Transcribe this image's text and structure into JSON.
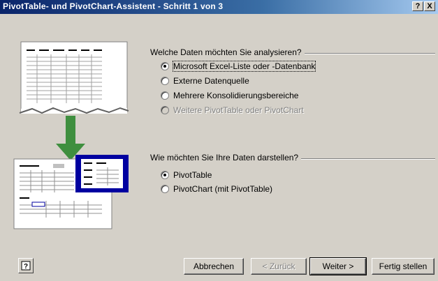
{
  "window": {
    "title": "PivotTable- und PivotChart-Assistent - Schritt 1 von 3",
    "help_glyph": "?",
    "close_glyph": "X"
  },
  "group_data_source": {
    "label": "Welche Daten möchten Sie analysieren?",
    "options": [
      {
        "label": "Microsoft Excel-Liste oder -Datenbank",
        "checked": true,
        "disabled": false
      },
      {
        "label": "Externe Datenquelle",
        "checked": false,
        "disabled": false
      },
      {
        "label": "Mehrere Konsolidierungsbereiche",
        "checked": false,
        "disabled": false
      },
      {
        "label": "Weitere PivotTable oder PivotChart",
        "checked": false,
        "disabled": true
      }
    ]
  },
  "group_report_type": {
    "label": "Wie möchten Sie Ihre Daten darstellen?",
    "options": [
      {
        "label": "PivotTable",
        "checked": true,
        "disabled": false
      },
      {
        "label": "PivotChart (mit PivotTable)",
        "checked": false,
        "disabled": false
      }
    ]
  },
  "buttons": {
    "cancel": "Abbrechen",
    "back": "< Zurück",
    "next": "Weiter >",
    "finish": "Fertig stellen"
  },
  "colors": {
    "dialog_bg": "#d4d0c8",
    "title_start": "#0a246a",
    "arrow": "#3f8f3f",
    "highlight": "#0000a0"
  }
}
